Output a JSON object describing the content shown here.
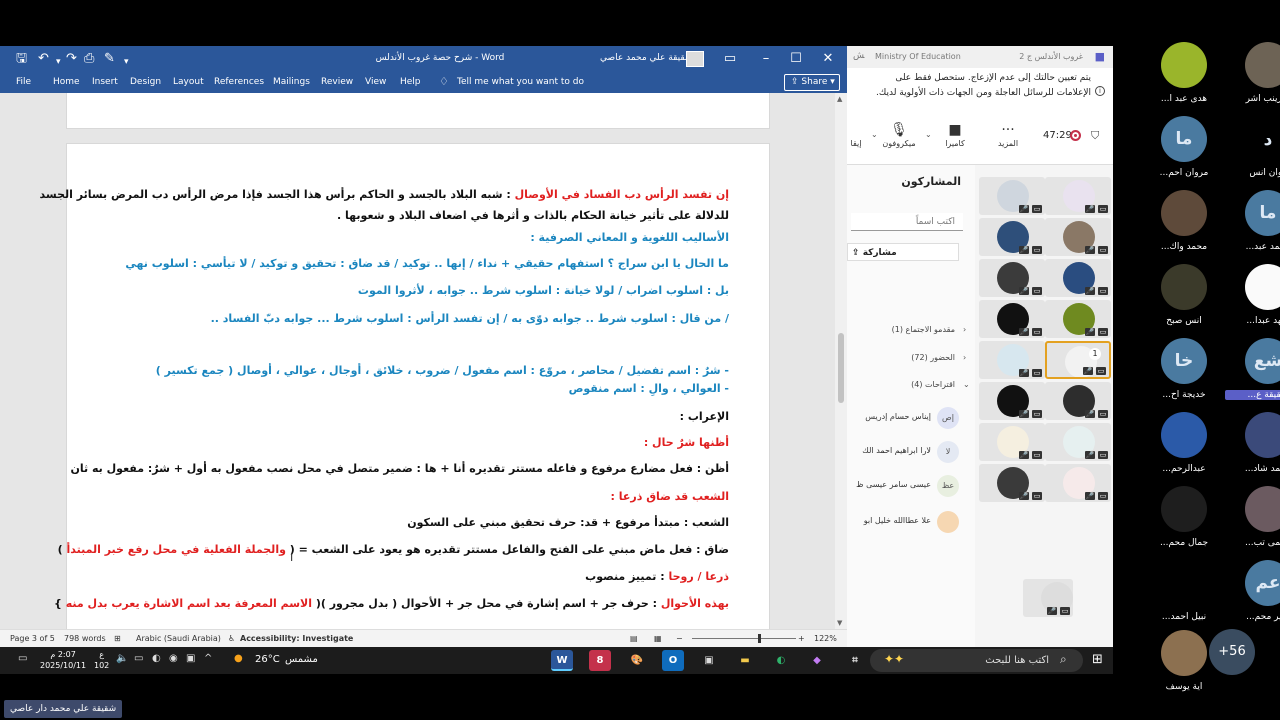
{
  "word": {
    "title": "شرح حصة غروب الأندلس  -  Word",
    "user": "شقيقة علي محمد عاصي",
    "tabs": [
      "File",
      "Home",
      "Insert",
      "Design",
      "Layout",
      "References",
      "Mailings",
      "Review",
      "View",
      "Help"
    ],
    "tell_me": "Tell me what you want to do",
    "share": "Share",
    "doc_lines": [
      {
        "segs": [
          {
            "t": "إن تفسد الرأس دب الفساد في الأوصال",
            "c": "red"
          },
          {
            "t": " : شبه البلاد بالجسد و الحاكم برأس هذا الجسد فإذا مرض الرأس دب المرض بسائر الجسد",
            "c": ""
          }
        ]
      },
      {
        "segs": [
          {
            "t": "للدلالة على تأثير خيانة الحكام بالذات و أثرها في اضعاف البلاد و شعوبها .",
            "c": ""
          }
        ]
      },
      {
        "segs": [
          {
            "t": "الأساليب اللغوية و المعاني الصرفية :",
            "c": "blue"
          }
        ]
      },
      {
        "segs": [
          {
            "t": "ما الحال يا ابن سراج ؟  استفهام حقيقي + نداء  /  إنها .. توكيد  /  قد ضاق : تحقيق و توكيد  /  لا تيأسي : اسلوب نهي",
            "c": "blue"
          }
        ]
      },
      {
        "segs": [
          {
            "t": "بل : اسلوب اضراب       /   لولا خيانة : اسلوب شرط .. جوابه ، لأثروا الموت",
            "c": "blue"
          }
        ]
      },
      {
        "segs": [
          {
            "t": "/ من قال : اسلوب شرط .. جوابه دوّى به  /   إن تفسد الرأس : اسلوب شرط ... جوابه دبّ الفساد ..",
            "c": "blue"
          }
        ]
      },
      {
        "segs": [
          {
            "t": "-     شرٌ : اسم تفضيل  /  محاصر ، مروّع : اسم مفعول  /  ضروب ، خلائق ، أوجال ، عوالي ، أوصال (  جمع تكسير )",
            "c": "blue"
          }
        ]
      },
      {
        "segs": [
          {
            "t": "-     العوالي ، والِ  :  اسم منقوص",
            "c": "blue"
          }
        ]
      },
      {
        "segs": [
          {
            "t": "الإعراب :",
            "c": ""
          }
        ]
      },
      {
        "segs": [
          {
            "t": "أظنها شرٌ حال  :",
            "c": "red"
          }
        ]
      },
      {
        "segs": [
          {
            "t": "أظن : فعل مضارع مرفوع و فاعله مستتر تقديره أنا + ها : ضمير متصل في محل نصب مفعول به أول + شرٌ: مفعول به ثان",
            "c": ""
          }
        ]
      },
      {
        "segs": [
          {
            "t": "الشعب قد ضاق ذرعا :",
            "c": "red"
          }
        ]
      },
      {
        "segs": [
          {
            "t": "الشعب : مبتدأ مرفوع + قد: حرف تحقيق مبني على السكون",
            "c": ""
          }
        ]
      },
      {
        "segs": [
          {
            "t": "ضاق : فعل ماض مبني على الفتح والفاعل مستتر تقديره هو يعود على الشعب = ( ",
            "c": ""
          },
          {
            "t": "والجملة الفعلية في محل رفع خبر المبتدأ",
            "c": "red"
          },
          {
            "t": " )",
            "c": ""
          }
        ]
      },
      {
        "segs": [
          {
            "t": "ذرعا  /  روحا",
            "c": "red"
          },
          {
            "t": "  :  تمييز منصوب",
            "c": ""
          }
        ]
      },
      {
        "segs": [
          {
            "t": "بهذه الأحوال",
            "c": "red"
          },
          {
            "t": " : حرف جر + اسم إشارة في محل جر + الأحوال ( بدل مجرور )( ",
            "c": ""
          },
          {
            "t": " الاسم المعرفة بعد اسم الاشارة يعرب بدل منه",
            "c": "red"
          },
          {
            "t": "  }",
            "c": ""
          }
        ]
      }
    ],
    "status": {
      "page": "Page 3 of 5",
      "words": "798 words",
      "lang": "Arabic (Saudi Arabia)",
      "access": "Accessibility: Investigate",
      "zoom": "122%"
    }
  },
  "teams": {
    "meeting_title": "غروب الأندلس ج 2",
    "org": "Ministry Of Education",
    "notice": "يتم تعيين حالتك إلى عدم الإزعاج. ستحصل فقط على الإعلامات للرسائل العاجلة ومن الجهات ذات الأولوية لديك.",
    "timer": "47:29",
    "controls": {
      "more": "المزيد",
      "camera": "كاميرا",
      "mic": "ميكروفون",
      "leave": "إيقا"
    },
    "participants_title": "المشاركون",
    "search_placeholder": "اكتب اسماً",
    "share_label": "مشاركة",
    "sections": {
      "organizers": "مقدمو الاجتماع (1)",
      "attendees": "الحضور (72)",
      "suggestions": "اقتراحات (4)"
    },
    "suggested": [
      {
        "initials": "إص",
        "name": "إيناس حسام إدريس"
      },
      {
        "initials": "لا",
        "name": "لارا ابراهيم احمد الك"
      },
      {
        "initials": "عظ",
        "name": "عيسى سامر عيسى ظ"
      },
      {
        "initials": "",
        "name": "علا عطاالله خليل ابو"
      }
    ],
    "active_count": "1"
  },
  "gallery": [
    {
      "initials": "",
      "name": "...زينب أشر"
    },
    {
      "initials": "",
      "name": "هدى عبد ا..."
    },
    {
      "initials": "د",
      "name": "روان أنس"
    },
    {
      "initials": "ما",
      "name": "مروان احم..."
    },
    {
      "initials": "ما",
      "name": "محمد عبد..."
    },
    {
      "initials": "",
      "name": "محمد واك..."
    },
    {
      "initials": "",
      "name": "شهد عبدا..."
    },
    {
      "initials": "",
      "name": "أنس صبح"
    },
    {
      "initials": "شع",
      "name": "شقيقة ع...",
      "highlight": true
    },
    {
      "initials": "خا",
      "name": "خديجة اح..."
    },
    {
      "initials": "",
      "name": "محمد شاد..."
    },
    {
      "initials": "",
      "name": "عبدالرحم..."
    },
    {
      "initials": "",
      "name": "سلمى تب..."
    },
    {
      "initials": "",
      "name": "جمال محم..."
    },
    {
      "initials": "عم",
      "name": "عبير محم..."
    },
    {
      "initials": "",
      "name": "نبيل أحمد..."
    },
    {
      "initials": "",
      "name": "آية يوسف"
    }
  ],
  "gallery_more": "+56",
  "taskbar": {
    "time": "2:07 م",
    "date": "2025/10/11",
    "lang": "ع",
    "lang2": "102",
    "weather_temp": "26°C",
    "weather_label": "مشمس",
    "search_placeholder": "اكتب هنا للبحث",
    "mail_badge": "8"
  },
  "caption": "شقيقة علي محمد دار عاصي"
}
